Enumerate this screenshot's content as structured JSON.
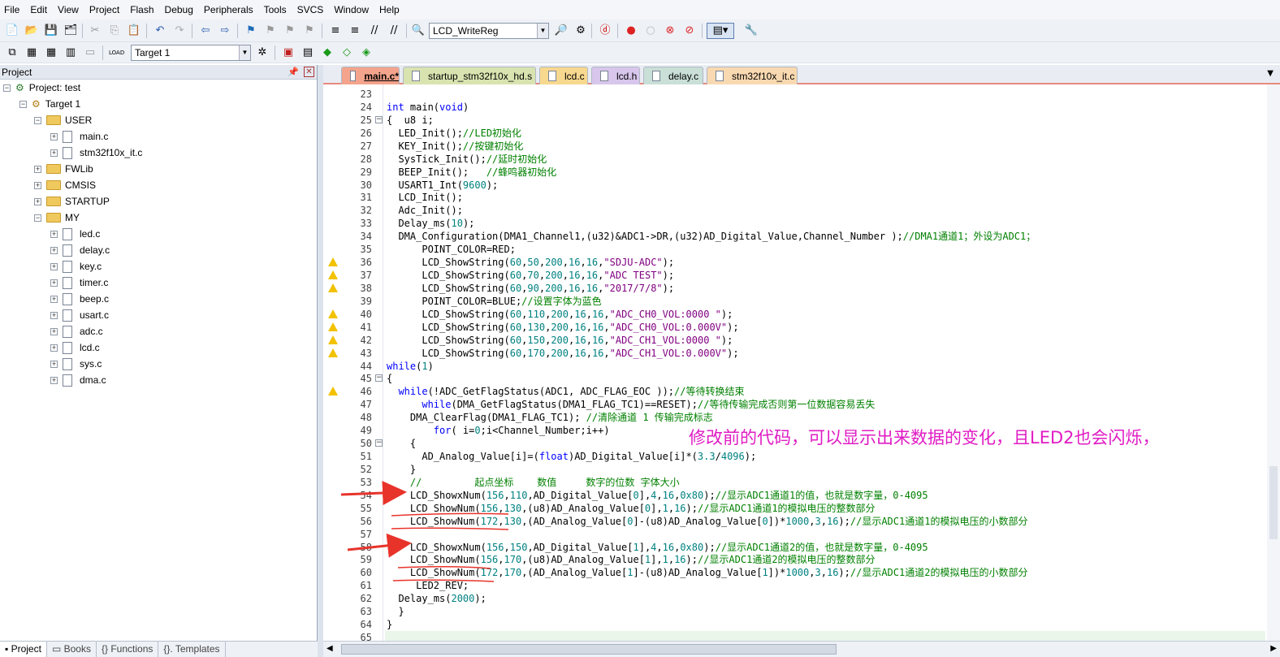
{
  "menu": [
    "File",
    "Edit",
    "View",
    "Project",
    "Flash",
    "Debug",
    "Peripherals",
    "Tools",
    "SVCS",
    "Window",
    "Help"
  ],
  "toolbar": {
    "function_combo": "LCD_WriteReg",
    "target_combo": "Target 1"
  },
  "project_panel": {
    "title": "Project",
    "root": "Project: test",
    "target": "Target 1",
    "groups": [
      {
        "name": "USER",
        "expanded": true,
        "files": [
          "main.c",
          "stm32f10x_it.c"
        ]
      },
      {
        "name": "FWLib",
        "expanded": false,
        "files": []
      },
      {
        "name": "CMSIS",
        "expanded": false,
        "files": []
      },
      {
        "name": "STARTUP",
        "expanded": false,
        "files": []
      },
      {
        "name": "MY",
        "expanded": true,
        "files": [
          "led.c",
          "delay.c",
          "key.c",
          "timer.c",
          "beep.c",
          "usart.c",
          "adc.c",
          "lcd.c",
          "sys.c",
          "dma.c"
        ]
      }
    ]
  },
  "bottom_tabs": [
    "Project",
    "Books",
    "Functions",
    "Templates"
  ],
  "editor_tabs": [
    {
      "label": "main.c*",
      "color": "#f4a48c",
      "active": true
    },
    {
      "label": "startup_stm32f10x_hd.s",
      "color": "#d9e3b0"
    },
    {
      "label": "lcd.c",
      "color": "#f7d88f"
    },
    {
      "label": "lcd.h",
      "color": "#d8c6ec"
    },
    {
      "label": "delay.c",
      "color": "#c9dfd7"
    },
    {
      "label": "stm32f10x_it.c",
      "color": "#f9d9b1"
    }
  ],
  "code_lines": [
    {
      "n": "23",
      "t": ""
    },
    {
      "n": "24",
      "t": "<span class=\"k\">int</span> main(<span class=\"k\">void</span>)"
    },
    {
      "n": "25",
      "t": "{  u8 i;",
      "fold": "−"
    },
    {
      "n": "26",
      "t": "  LED_Init();<span class=\"c\">//LED初始化</span>"
    },
    {
      "n": "27",
      "t": "  KEY_Init();<span class=\"c\">//按键初始化</span>"
    },
    {
      "n": "28",
      "t": "  SysTick_Init();<span class=\"c\">//延时初始化</span>"
    },
    {
      "n": "29",
      "t": "  BEEP_Init();   <span class=\"c\">//蜂鸣器初始化</span>"
    },
    {
      "n": "30",
      "t": "  USART1_Int(<span class=\"n\">9600</span>);"
    },
    {
      "n": "31",
      "t": "  LCD_Init();"
    },
    {
      "n": "32",
      "t": "  Adc_Init();"
    },
    {
      "n": "33",
      "t": "  Delay_ms(<span class=\"n\">10</span>);"
    },
    {
      "n": "34",
      "t": "  DMA_Configuration(DMA1_Channel1,(u32)&amp;ADC1-&gt;DR,(u32)AD_Digital_Value,Channel_Number );<span class=\"c\">//DMA1通道1；外设为ADC1；</span>"
    },
    {
      "n": "35",
      "t": "      POINT_COLOR=RED;"
    },
    {
      "n": "36",
      "t": "      LCD_ShowString(<span class=\"n\">60</span>,<span class=\"n\">50</span>,<span class=\"n\">200</span>,<span class=\"n\">16</span>,<span class=\"n\">16</span>,<span class=\"s\">\"SDJU-ADC\"</span>);",
      "warn": true
    },
    {
      "n": "37",
      "t": "      LCD_ShowString(<span class=\"n\">60</span>,<span class=\"n\">70</span>,<span class=\"n\">200</span>,<span class=\"n\">16</span>,<span class=\"n\">16</span>,<span class=\"s\">\"ADC TEST\"</span>);",
      "warn": true
    },
    {
      "n": "38",
      "t": "      LCD_ShowString(<span class=\"n\">60</span>,<span class=\"n\">90</span>,<span class=\"n\">200</span>,<span class=\"n\">16</span>,<span class=\"n\">16</span>,<span class=\"s\">\"2017/7/8\"</span>);",
      "warn": true
    },
    {
      "n": "39",
      "t": "      POINT_COLOR=BLUE;<span class=\"c\">//设置字体为蓝色</span>"
    },
    {
      "n": "40",
      "t": "      LCD_ShowString(<span class=\"n\">60</span>,<span class=\"n\">110</span>,<span class=\"n\">200</span>,<span class=\"n\">16</span>,<span class=\"n\">16</span>,<span class=\"s\">\"ADC_CH0_VOL:0000 \"</span>);",
      "warn": true
    },
    {
      "n": "41",
      "t": "      LCD_ShowString(<span class=\"n\">60</span>,<span class=\"n\">130</span>,<span class=\"n\">200</span>,<span class=\"n\">16</span>,<span class=\"n\">16</span>,<span class=\"s\">\"ADC_CH0_VOL:0.000V\"</span>);",
      "warn": true
    },
    {
      "n": "42",
      "t": "      LCD_ShowString(<span class=\"n\">60</span>,<span class=\"n\">150</span>,<span class=\"n\">200</span>,<span class=\"n\">16</span>,<span class=\"n\">16</span>,<span class=\"s\">\"ADC_CH1_VOL:0000 \"</span>);",
      "warn": true
    },
    {
      "n": "43",
      "t": "      LCD_ShowString(<span class=\"n\">60</span>,<span class=\"n\">170</span>,<span class=\"n\">200</span>,<span class=\"n\">16</span>,<span class=\"n\">16</span>,<span class=\"s\">\"ADC_CH1_VOL:0.000V\"</span>);",
      "warn": true
    },
    {
      "n": "44",
      "t": "<span class=\"k\">while</span>(<span class=\"n\">1</span>)"
    },
    {
      "n": "45",
      "t": "{",
      "fold": "−"
    },
    {
      "n": "46",
      "t": "  <span class=\"k\">while</span>(!ADC_GetFlagStatus(ADC1, ADC_FLAG_EOC ));<span class=\"c\">//等待转换结束</span>",
      "warn": true
    },
    {
      "n": "47",
      "t": "      <span class=\"k\">while</span>(DMA_GetFlagStatus(DMA1_FLAG_TC1)==RESET);<span class=\"c\">//等待传输完成否则第一位数据容易丢失</span>"
    },
    {
      "n": "48",
      "t": "    DMA_ClearFlag(DMA1_FLAG_TC1); <span class=\"c\">//清除通道 1 传输完成标志</span>"
    },
    {
      "n": "49",
      "t": "        <span class=\"k\">for</span>( i=<span class=\"n\">0</span>;i&lt;Channel_Number;i++)"
    },
    {
      "n": "50",
      "t": "    {",
      "fold": "−"
    },
    {
      "n": "51",
      "t": "      AD_Analog_Value[i]=(<span class=\"k\">float</span>)AD_Digital_Value[i]*(<span class=\"n\">3.3</span>/<span class=\"n\">4096</span>);"
    },
    {
      "n": "52",
      "t": "    }"
    },
    {
      "n": "53",
      "t": "    <span class=\"c\">//         起点坐标    数值     数字的位数 字体大小</span>"
    },
    {
      "n": "54",
      "t": "    LCD_ShowxNum(<span class=\"n\">156</span>,<span class=\"n\">110</span>,AD_Digital_Value[<span class=\"n\">0</span>],<span class=\"n\">4</span>,<span class=\"n\">16</span>,<span class=\"n\">0x80</span>);<span class=\"c\">//显示ADC1通道1的值，也就是数字量，0-4095</span>"
    },
    {
      "n": "55",
      "t": "    LCD_ShowNum(<span class=\"n\">156</span>,<span class=\"n\">130</span>,(u8)AD_Analog_Value[<span class=\"n\">0</span>],<span class=\"n\">1</span>,<span class=\"n\">16</span>);<span class=\"c\">//显示ADC1通道1的模拟电压的整数部分</span>"
    },
    {
      "n": "56",
      "t": "    LCD_ShowNum(<span class=\"n\">172</span>,<span class=\"n\">130</span>,(AD_Analog_Value[<span class=\"n\">0</span>]-(u8)AD_Analog_Value[<span class=\"n\">0</span>])*<span class=\"n\">1000</span>,<span class=\"n\">3</span>,<span class=\"n\">16</span>);<span class=\"c\">//显示ADC1通道1的模拟电压的小数部分</span>"
    },
    {
      "n": "57",
      "t": ""
    },
    {
      "n": "58",
      "t": "    LCD_ShowxNum(<span class=\"n\">156</span>,<span class=\"n\">150</span>,AD_Digital_Value[<span class=\"n\">1</span>],<span class=\"n\">4</span>,<span class=\"n\">16</span>,<span class=\"n\">0x80</span>);<span class=\"c\">//显示ADC1通道2的值，也就是数字量，0-4095</span>"
    },
    {
      "n": "59",
      "t": "    LCD_ShowNum(<span class=\"n\">156</span>,<span class=\"n\">170</span>,(u8)AD_Analog_Value[<span class=\"n\">1</span>],<span class=\"n\">1</span>,<span class=\"n\">16</span>);<span class=\"c\">//显示ADC1通道2的模拟电压的整数部分</span>"
    },
    {
      "n": "60",
      "t": "    LCD_ShowNum(<span class=\"n\">172</span>,<span class=\"n\">170</span>,(AD_Analog_Value[<span class=\"n\">1</span>]-(u8)AD_Analog_Value[<span class=\"n\">1</span>])*<span class=\"n\">1000</span>,<span class=\"n\">3</span>,<span class=\"n\">16</span>);<span class=\"c\">//显示ADC1通道2的模拟电压的小数部分</span>"
    },
    {
      "n": "61",
      "t": "     LED2_REV;"
    },
    {
      "n": "62",
      "t": "  Delay_ms(<span class=\"n\">2000</span>);"
    },
    {
      "n": "63",
      "t": "  }"
    },
    {
      "n": "64",
      "t": "}"
    },
    {
      "n": "65",
      "t": ""
    }
  ],
  "annotation": "修改前的代码，可以显示出来数据的变化，且LED2也会闪烁，"
}
